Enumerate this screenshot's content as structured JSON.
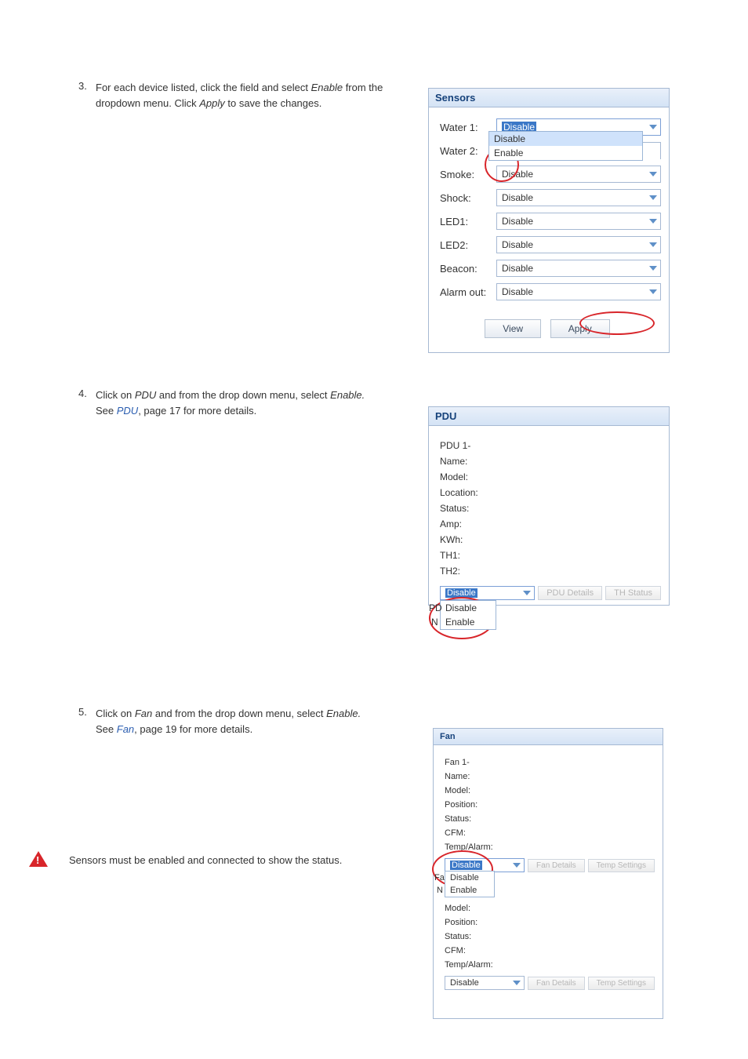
{
  "step3": {
    "number": "3.",
    "text_a": "For each device listed, click the field and select ",
    "text_b": " from the dropdown menu. Click ",
    "text_c": " to save the changes.",
    "enable": "Enable",
    "apply": "Apply"
  },
  "sensors_panel": {
    "title": "Sensors",
    "rows": [
      {
        "label": "Water 1:",
        "value": "Disable"
      },
      {
        "label": "Water 2:",
        "value": "Disable"
      },
      {
        "label": "Smoke:",
        "value": "Disable"
      },
      {
        "label": "Shock:",
        "value": "Disable"
      },
      {
        "label": "LED1:",
        "value": "Disable"
      },
      {
        "label": "LED2:",
        "value": "Disable"
      },
      {
        "label": "Beacon:",
        "value": "Disable"
      },
      {
        "label": "Alarm out:",
        "value": "Disable"
      }
    ],
    "open_options": [
      "Disable",
      "Enable"
    ],
    "buttons": {
      "view": "View",
      "apply": "Apply"
    }
  },
  "step4": {
    "number": "4.",
    "text_a": "Click on ",
    "text_b": " and from the drop down menu, select ",
    "text_c": "See ",
    "text_d": ", page 17 for more details.",
    "pdu": "PDU",
    "enable": "Enable.",
    "link": "PDU"
  },
  "pdu_panel": {
    "title": "PDU",
    "heading": "PDU 1-",
    "fields": [
      "Name:",
      "Model:",
      "Location:",
      "Status:",
      "Amp:",
      "KWh:",
      "TH1:",
      "TH2:"
    ],
    "select_value": "Disable",
    "buttons": {
      "details": "PDU Details",
      "th": "TH Status"
    },
    "open_options_prefix": [
      "PD",
      "N"
    ],
    "open_options": [
      "Disable",
      "Enable"
    ]
  },
  "step5": {
    "number": "5.",
    "text_a": "Click on ",
    "text_b": " and from the drop down menu, select ",
    "text_c": "See ",
    "text_d": ", page 19 for more details.",
    "fan": "Fan",
    "enable": "Enable.",
    "link": "Fan"
  },
  "fan_panel": {
    "title": "Fan",
    "heading1": "Fan 1-",
    "fields1": [
      "Name:",
      "Model:",
      "Position:",
      "Status:",
      "CFM:",
      "Temp/Alarm:"
    ],
    "select1_value": "Disable",
    "buttons1": {
      "details": "Fan Details",
      "settings": "Temp Settings"
    },
    "open_options_prefix": [
      "Fa",
      "N"
    ],
    "open_options": [
      "Disable",
      "Enable"
    ],
    "fields2": [
      "Model:",
      "Position:",
      "Status:",
      "CFM:",
      "Temp/Alarm:"
    ],
    "select2_value": "Disable",
    "buttons2": {
      "details": "Fan Details",
      "settings": "Temp Settings"
    }
  },
  "warning": "Sensors must be enabled and connected to show the status."
}
